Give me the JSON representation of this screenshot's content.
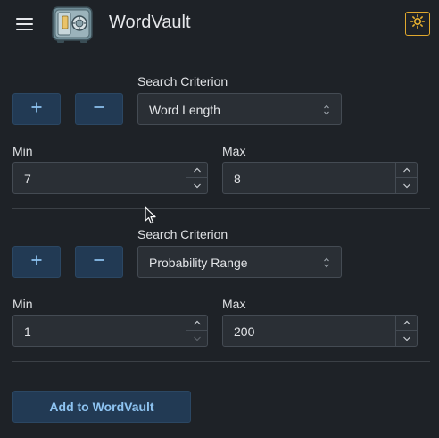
{
  "app": {
    "title": "WordVault"
  },
  "header": {
    "menu_icon": "hamburger-menu-icon",
    "logo_icon": "vault-safe-icon",
    "theme_icon": "sun-icon"
  },
  "criteria": [
    {
      "label": "Search Criterion",
      "selected": "Word Length",
      "min_label": "Min",
      "min_value": "7",
      "max_label": "Max",
      "max_value": "8"
    },
    {
      "label": "Search Criterion",
      "selected": "Probability Range",
      "min_label": "Min",
      "min_value": "1",
      "max_label": "Max",
      "max_value": "200"
    }
  ],
  "actions": {
    "add_label": "Add to WordVault"
  },
  "colors": {
    "accent": "#8ec4f2",
    "button_bg": "#223a54",
    "theme_border": "#e0a82e",
    "background": "#1e2227"
  }
}
